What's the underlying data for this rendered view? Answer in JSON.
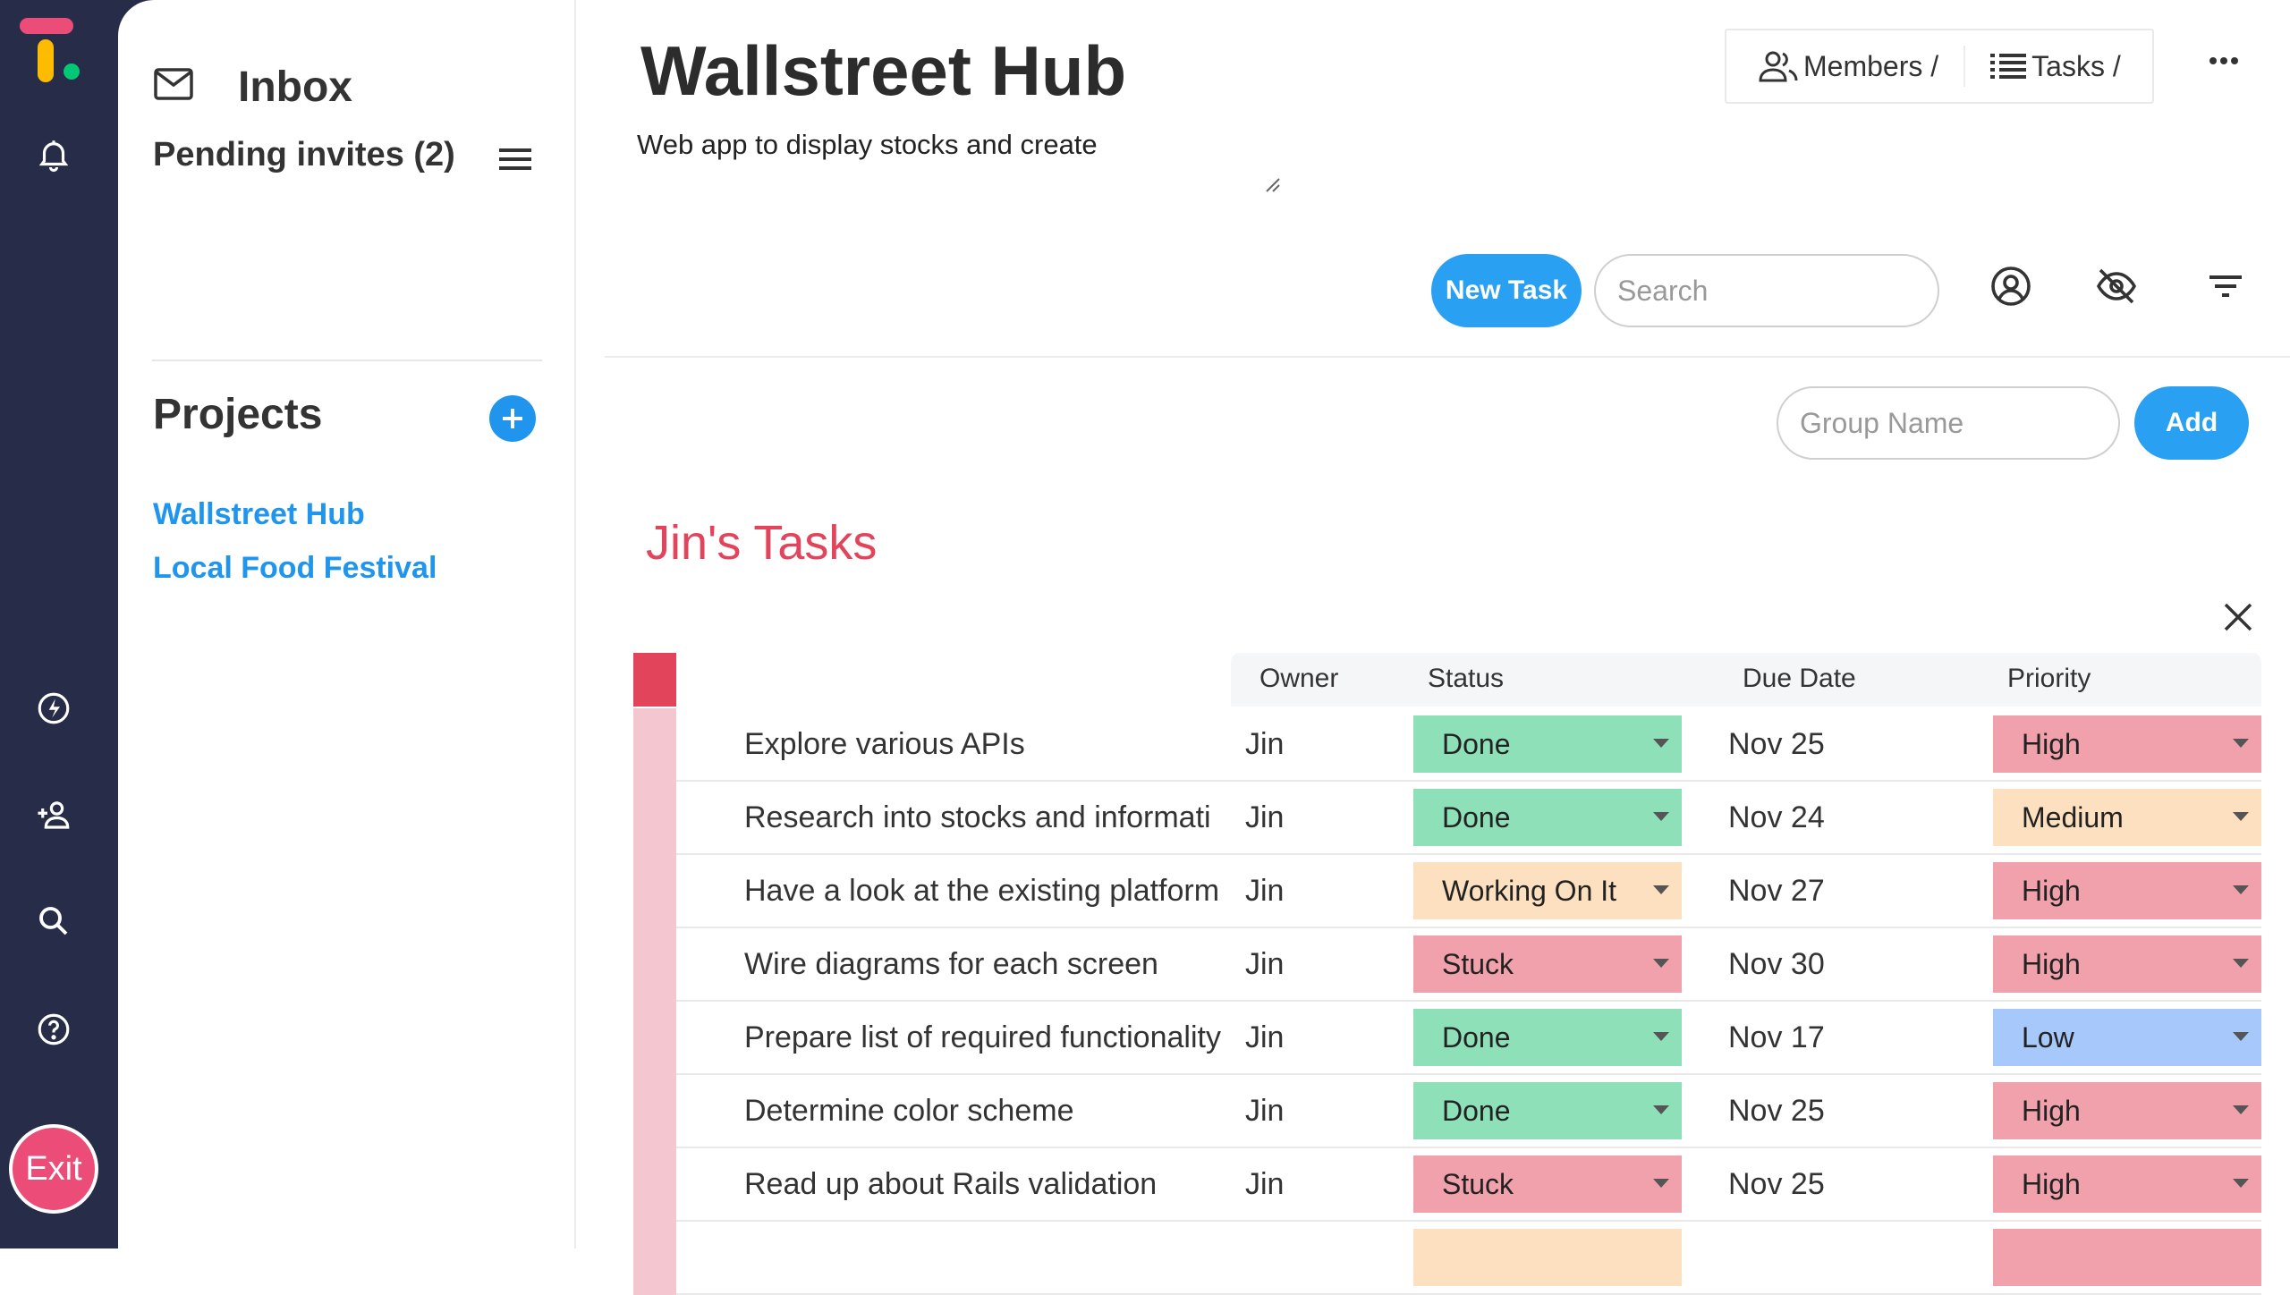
{
  "sidebar": {
    "inbox_label": "Inbox",
    "pending_invites": "Pending invites (2)",
    "projects_title": "Projects",
    "projects": [
      "Wallstreet Hub",
      "Local Food Festival"
    ]
  },
  "rail": {
    "logo_colors": [
      "#ec4d78",
      "#fdbc02",
      "#00c875"
    ],
    "icons": [
      "bell-icon",
      "lightning-icon",
      "add-user-icon",
      "search-icon",
      "help-icon"
    ],
    "exit_label": "Exit"
  },
  "header": {
    "title": "Wallstreet Hub",
    "description": "Web app to display stocks and create",
    "members_tab": "Members /",
    "tasks_tab": "Tasks /"
  },
  "toolbar": {
    "new_task_label": "New Task",
    "search_placeholder": "Search",
    "group_name_placeholder": "Group Name",
    "add_label": "Add"
  },
  "group": {
    "title": "Jin's Tasks",
    "color": "#e2445c",
    "columns": [
      "Owner",
      "Status",
      "Due Date",
      "Priority"
    ],
    "rows": [
      {
        "name": "Explore various APIs",
        "owner": "Jin",
        "status": "Done",
        "due": "Nov 25",
        "priority": "High"
      },
      {
        "name": "Research into stocks and informati",
        "owner": "Jin",
        "status": "Done",
        "due": "Nov 24",
        "priority": "Medium"
      },
      {
        "name": "Have a look at the existing platform",
        "owner": "Jin",
        "status": "Working On It",
        "due": "Nov 27",
        "priority": "High"
      },
      {
        "name": "Wire diagrams for each screen",
        "owner": "Jin",
        "status": "Stuck",
        "due": "Nov 30",
        "priority": "High"
      },
      {
        "name": "Prepare list of required functionality",
        "owner": "Jin",
        "status": "Done",
        "due": "Nov 17",
        "priority": "Low"
      },
      {
        "name": "Determine color scheme",
        "owner": "Jin",
        "status": "Done",
        "due": "Nov 25",
        "priority": "High"
      },
      {
        "name": "Read up about Rails validation",
        "owner": "Jin",
        "status": "Stuck",
        "due": "Nov 25",
        "priority": "High"
      }
    ]
  },
  "colors": {
    "done": "#8ee0b8",
    "working": "#fde0bf",
    "stuck": "#f0a1ab",
    "high": "#f0a1ab",
    "medium": "#fde0bf",
    "low": "#a7c8fb",
    "accent": "#29a0f2"
  }
}
